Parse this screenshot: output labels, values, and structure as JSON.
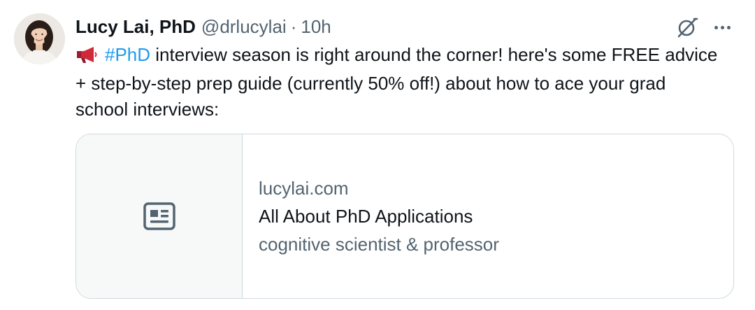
{
  "author": {
    "name": "Lucy Lai, PhD",
    "handle": "@drlucylai",
    "separator": "·",
    "time": "10h"
  },
  "icons": {
    "avatar": "profile-photo",
    "grok": "grok-icon",
    "more": "more-icon",
    "megaphone": "megaphone-emoji",
    "card_thumbnail": "article-icon"
  },
  "tweet": {
    "hashtag": "#PhD",
    "text_after_hashtag": " interview season is right around the corner! here's some FREE advice + step-by-step prep guide (currently 50% off!) about how to ace your grad school interviews:"
  },
  "card": {
    "domain": "lucylai.com",
    "title": "All About PhD Applications",
    "description": "cognitive scientist & professor"
  },
  "colors": {
    "text_primary": "#0f1419",
    "text_secondary": "#536471",
    "link": "#1d9bf0",
    "border": "#cfd9de",
    "card_thumb_bg": "#f7f9f9"
  }
}
